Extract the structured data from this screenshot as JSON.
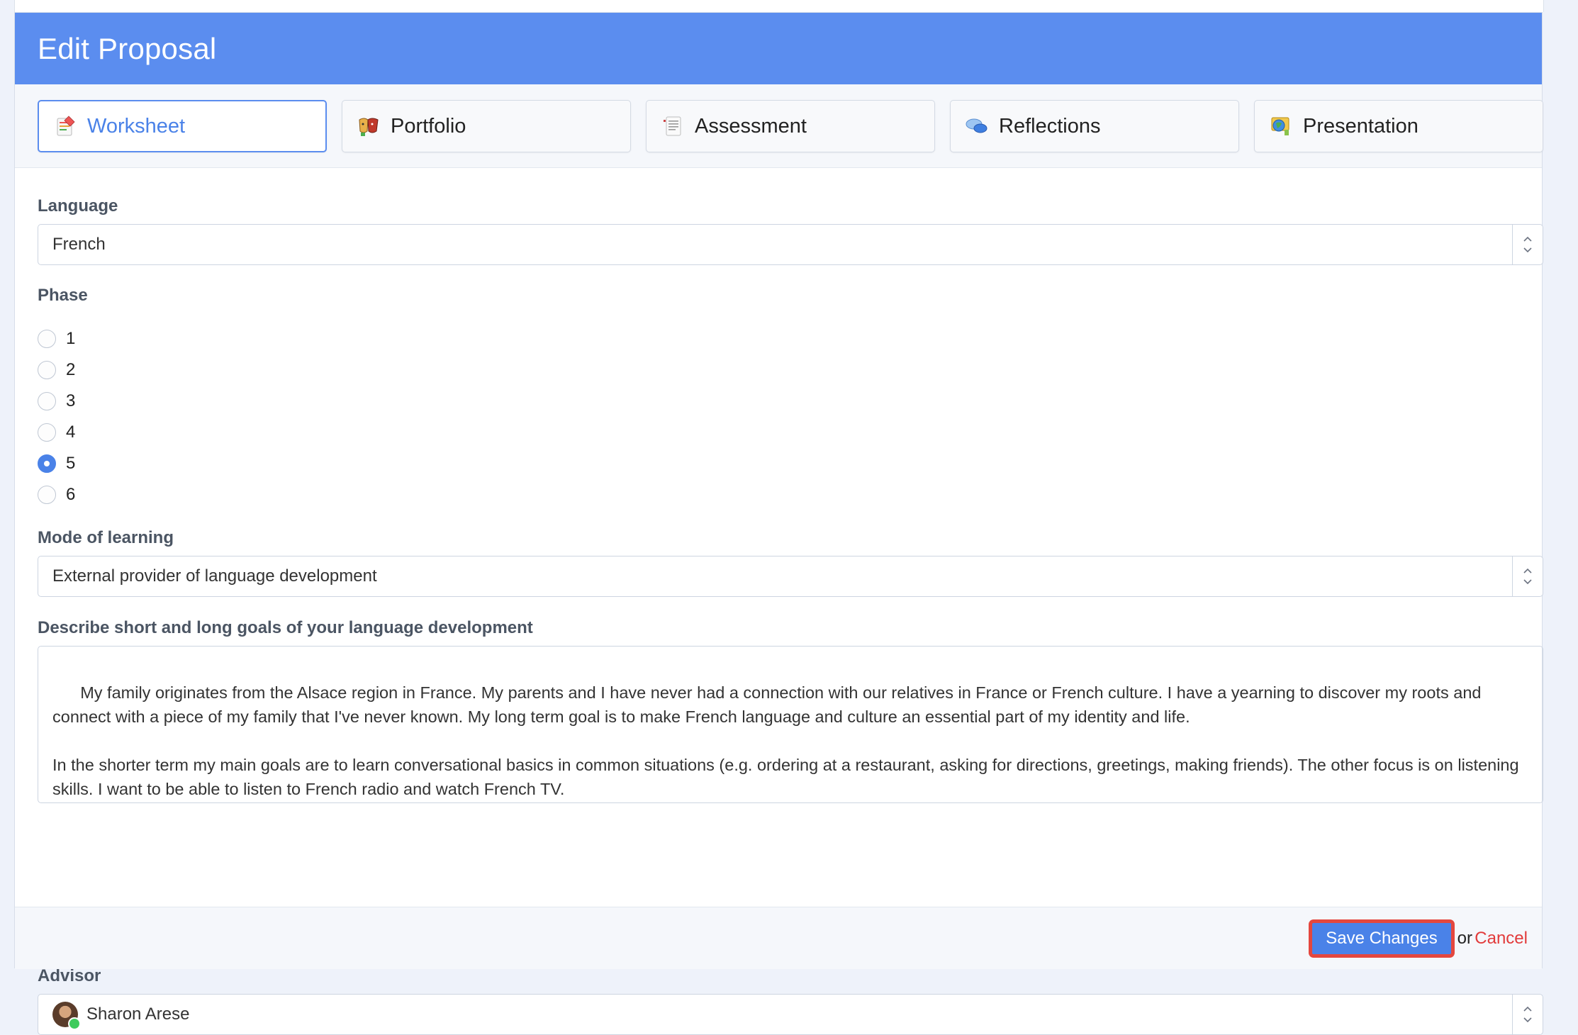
{
  "dialog": {
    "title": "Edit Proposal"
  },
  "tabs": [
    {
      "label": "Worksheet",
      "icon": "worksheet-icon",
      "active": true
    },
    {
      "label": "Portfolio",
      "icon": "portfolio-icon",
      "active": false
    },
    {
      "label": "Assessment",
      "icon": "assessment-icon",
      "active": false
    },
    {
      "label": "Reflections",
      "icon": "reflections-icon",
      "active": false
    },
    {
      "label": "Presentation",
      "icon": "presentation-icon",
      "active": false
    }
  ],
  "language": {
    "label": "Language",
    "value": "French"
  },
  "phase": {
    "label": "Phase",
    "options": [
      "1",
      "2",
      "3",
      "4",
      "5",
      "6"
    ],
    "selected": "5"
  },
  "mode": {
    "label": "Mode of learning",
    "value": "External provider of language development"
  },
  "goals": {
    "label": "Describe short and long goals of your language development",
    "value": "My family originates from the Alsace region in France. My parents and I have never had a connection with our relatives in France or French culture. I have a yearning to discover my roots and connect with a piece of my family that I've never known. My long term goal is to make French language and culture an essential part of my identity and life.\n\nIn the shorter term my main goals are to learn conversational basics in common situations (e.g. ordering at a restaurant, asking for directions, greetings, making friends). The other focus is on listening skills. I want to be able to listen to French radio and watch French TV."
  },
  "advisor": {
    "label": "Advisor",
    "value": "Sharon Arese",
    "status": "online"
  },
  "footer": {
    "save_label": "Save Changes",
    "or_text": "or",
    "cancel_label": "Cancel"
  },
  "colors": {
    "header": "#5b8def",
    "accent": "#4a82e8",
    "cancel": "#e23b3b",
    "highlight": "#e4473e"
  }
}
